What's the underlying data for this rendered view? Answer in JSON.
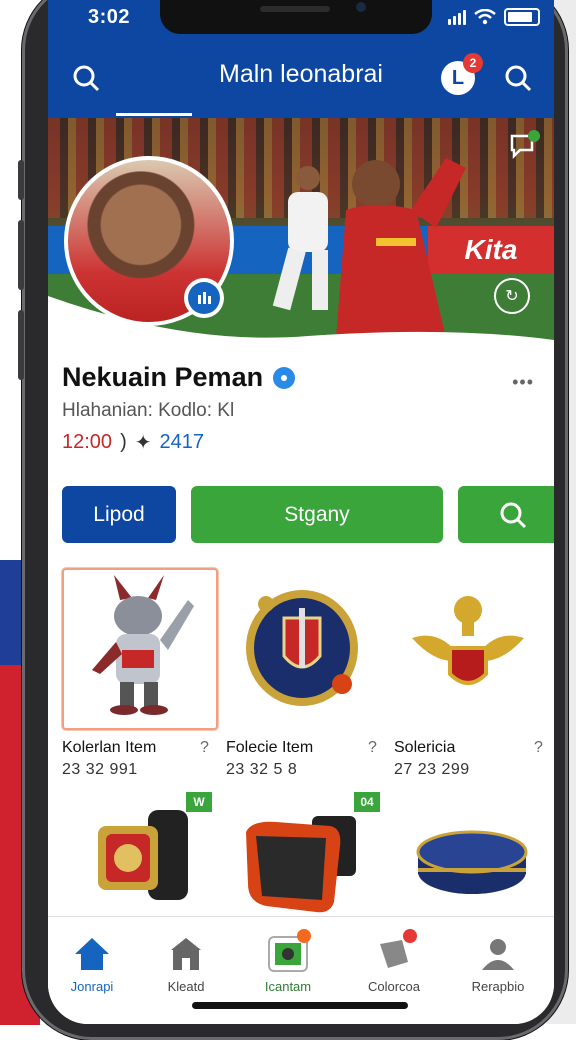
{
  "status_bar": {
    "time": "3:02"
  },
  "header": {
    "title": "Maln leonabrai",
    "brand_letter": "L",
    "notification_count": "2"
  },
  "banner": {
    "ad_text": "Kita"
  },
  "profile": {
    "name": "Nekuain Peman",
    "handle": "Hlahanian: Kodlo:",
    "handle_suffix": "Kl",
    "time": "12:00",
    "separator": ")",
    "count": "2417"
  },
  "actions": {
    "primary_label": "Lipod",
    "secondary_label": "Stgany"
  },
  "items": [
    {
      "title": "Kolerlan Item",
      "meta": "23 32 991",
      "chev": "?"
    },
    {
      "title": "Folecie Item",
      "meta": "23 32 5 8",
      "chev": "?"
    },
    {
      "title": "Solericia",
      "meta": "27 23 299",
      "chev": "?"
    },
    {
      "tag": "W"
    },
    {
      "tag": "04"
    },
    {}
  ],
  "nav": [
    {
      "label": "Jonrapi",
      "icon": "home-icon"
    },
    {
      "label": "Kleatd",
      "icon": "store-icon"
    },
    {
      "label": "Icantam",
      "icon": "scan-icon"
    },
    {
      "label": "Colorcoa",
      "icon": "tag-icon"
    },
    {
      "label": "Rerapbio",
      "icon": "profile-icon"
    }
  ],
  "colors": {
    "primary": "#0d47a1",
    "accent_green": "#3aa53b",
    "alert_red": "#e53935"
  }
}
